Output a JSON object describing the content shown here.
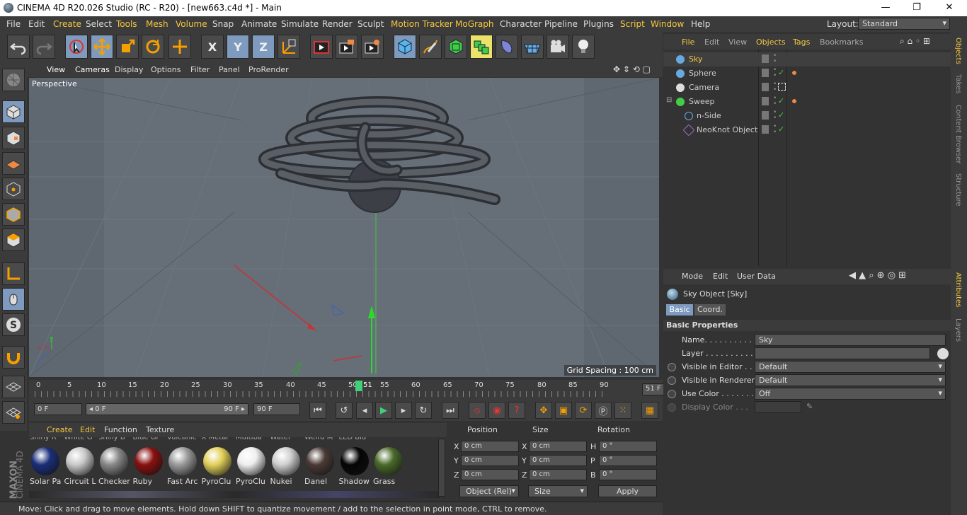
{
  "window": {
    "title": "CINEMA 4D R20.026 Studio (RC - R20) - [new663.c4d *] - Main",
    "minimize": "—",
    "restore": "❐",
    "close": "✕"
  },
  "menubar": {
    "items": [
      "File",
      "Edit",
      "Create",
      "Select",
      "Tools",
      "Mesh",
      "Volume",
      "Snap",
      "Animate",
      "Simulate",
      "Render",
      "Sculpt",
      "Motion Tracker",
      "MoGraph",
      "Character",
      "Pipeline",
      "Plugins",
      "Script",
      "Window",
      "Help"
    ],
    "layout_label": "Layout:",
    "layout_value": "Standard"
  },
  "toolbar": {
    "x_label": "X",
    "y_label": "Y",
    "z_label": "Z"
  },
  "viewport_menu": {
    "items": [
      "View",
      "Cameras",
      "Display",
      "Options",
      "Filter",
      "Panel",
      "ProRender"
    ]
  },
  "viewport": {
    "label": "Perspective",
    "grid_spacing": "Grid Spacing : 100 cm"
  },
  "timeline": {
    "ticks": [
      "0",
      "5",
      "10",
      "15",
      "20",
      "25",
      "30",
      "35",
      "40",
      "45",
      "50",
      "55",
      "60",
      "65",
      "70",
      "75",
      "80",
      "85",
      "90"
    ],
    "playhead": "51",
    "current_frame": "51 F"
  },
  "playback": {
    "start": "0 F",
    "range_start": "◂ 0 F",
    "range_end": "90 F ▸",
    "end": "90 F"
  },
  "materials": {
    "menu": [
      "Create",
      "Edit",
      "Function",
      "Texture"
    ],
    "top_row": [
      "Shiny R",
      "White G",
      "Shiny B",
      "Blue Gl",
      "Vulcanic",
      "X Metal",
      "Multiba",
      "Water",
      "Weird M",
      "LED Blu"
    ],
    "items": [
      {
        "label": "Solar Pa",
        "color": "#1b2f7a"
      },
      {
        "label": "Circuit L",
        "color": "#c9c9c9"
      },
      {
        "label": "Checker",
        "color": "#888888"
      },
      {
        "label": "Ruby",
        "color": "#8a1010"
      },
      {
        "label": "Fast Arc",
        "color": "#9a9a9a"
      },
      {
        "label": "PyroClu",
        "color": "#e2d05a"
      },
      {
        "label": "PyroClu",
        "color": "#eeeeee"
      },
      {
        "label": "Nukei",
        "color": "#cfcfcf"
      },
      {
        "label": "Danel",
        "color": "#4a3a36"
      },
      {
        "label": "Shadow",
        "color": "#050505"
      },
      {
        "label": "Grass",
        "color": "#4a6a2a"
      }
    ]
  },
  "coords": {
    "headers": [
      "Position",
      "Size",
      "Rotation"
    ],
    "rows": [
      {
        "axis": "X",
        "pos": "0 cm",
        "size_axis": "X",
        "size": "0 cm",
        "rot_axis": "H",
        "rot": "0 °"
      },
      {
        "axis": "Y",
        "pos": "0 cm",
        "size_axis": "Y",
        "size": "0 cm",
        "rot_axis": "P",
        "rot": "0 °"
      },
      {
        "axis": "Z",
        "pos": "0 cm",
        "size_axis": "Z",
        "size": "0 cm",
        "rot_axis": "B",
        "rot": "0 °"
      }
    ],
    "mode": "Object (Rel)",
    "size_mode": "Size",
    "apply": "Apply"
  },
  "status": "Move: Click and drag to move elements. Hold down SHIFT to quantize movement / add to the selection in point mode, CTRL to remove.",
  "brand": {
    "line1": "MAXON",
    "line2": "CINEMA 4D"
  },
  "objects_panel": {
    "menu": [
      "File",
      "Edit",
      "View",
      "Objects",
      "Tags",
      "Bookmarks"
    ],
    "items": [
      {
        "name": "Sky",
        "indent": 0,
        "selected": true
      },
      {
        "name": "Sphere",
        "indent": 0
      },
      {
        "name": "Camera",
        "indent": 0
      },
      {
        "name": "Sweep",
        "indent": 0
      },
      {
        "name": "n-Side",
        "indent": 1
      },
      {
        "name": "NeoKnot Object",
        "indent": 1
      }
    ]
  },
  "right_tabs": [
    "Objects",
    "Takes",
    "Content Browser",
    "Structure",
    "Attributes",
    "Layers"
  ],
  "attributes": {
    "menu": [
      "Mode",
      "Edit",
      "User Data"
    ],
    "object_title": "Sky Object [Sky]",
    "tabs": [
      "Basic",
      "Coord."
    ],
    "section": "Basic Properties",
    "fields": [
      {
        "label": "Name. . . . . . . . . . . . .",
        "value": "Sky"
      },
      {
        "label": "Layer . . . . . . . . . . . .",
        "value": ""
      },
      {
        "label": "Visible in Editor . .",
        "value": "Default"
      },
      {
        "label": "Visible in Renderer",
        "value": "Default"
      },
      {
        "label": "Use Color . . . . . . .",
        "value": "Off"
      },
      {
        "label": "Display Color . . .",
        "value": ""
      }
    ]
  }
}
